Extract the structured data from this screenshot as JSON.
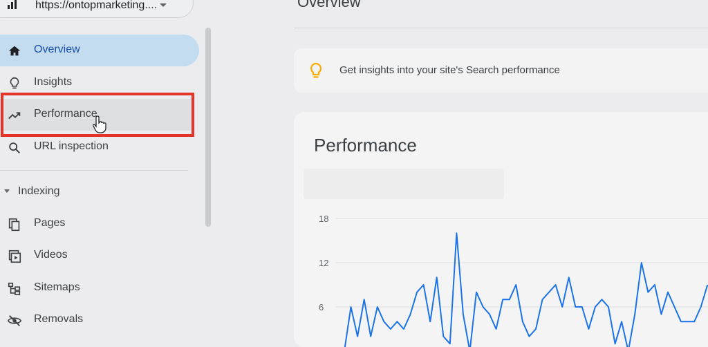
{
  "property": {
    "url": "https://ontopmarketing...."
  },
  "sidebar": {
    "items": [
      {
        "label": "Overview",
        "icon": "home-icon"
      },
      {
        "label": "Insights",
        "icon": "lightbulb-icon"
      },
      {
        "label": "Performance",
        "icon": "trending-up-icon"
      },
      {
        "label": "URL inspection",
        "icon": "search-icon"
      }
    ],
    "section": {
      "label": "Indexing",
      "items": [
        {
          "label": "Pages",
          "icon": "pages-icon"
        },
        {
          "label": "Videos",
          "icon": "video-icon"
        },
        {
          "label": "Sitemaps",
          "icon": "sitemap-icon"
        },
        {
          "label": "Removals",
          "icon": "eye-off-icon"
        }
      ]
    }
  },
  "main": {
    "title": "Overview",
    "insight_text": "Get insights into your site's Search performance",
    "performance_title": "Performance"
  },
  "colors": {
    "accent": "#1a73e8",
    "active_bg": "#c3dcf0",
    "highlight": "#e5332a",
    "lightbulb": "#f9ab00"
  },
  "chart_data": {
    "type": "line",
    "y_ticks": [
      "18",
      "12",
      "6"
    ],
    "ylim": [
      0,
      18
    ],
    "series": [
      {
        "values": [
          0,
          6,
          2,
          7,
          2,
          6,
          4,
          3,
          4,
          3,
          5,
          8,
          9,
          4,
          10,
          2,
          1,
          16,
          5,
          0,
          8,
          6,
          5,
          3,
          7,
          7,
          9,
          4,
          2,
          3,
          7,
          8,
          9,
          6,
          10,
          6,
          6,
          3,
          6,
          7,
          6,
          1,
          4,
          0,
          5,
          12,
          8,
          9,
          5,
          8,
          6,
          4,
          4,
          4,
          6,
          9
        ]
      }
    ]
  }
}
